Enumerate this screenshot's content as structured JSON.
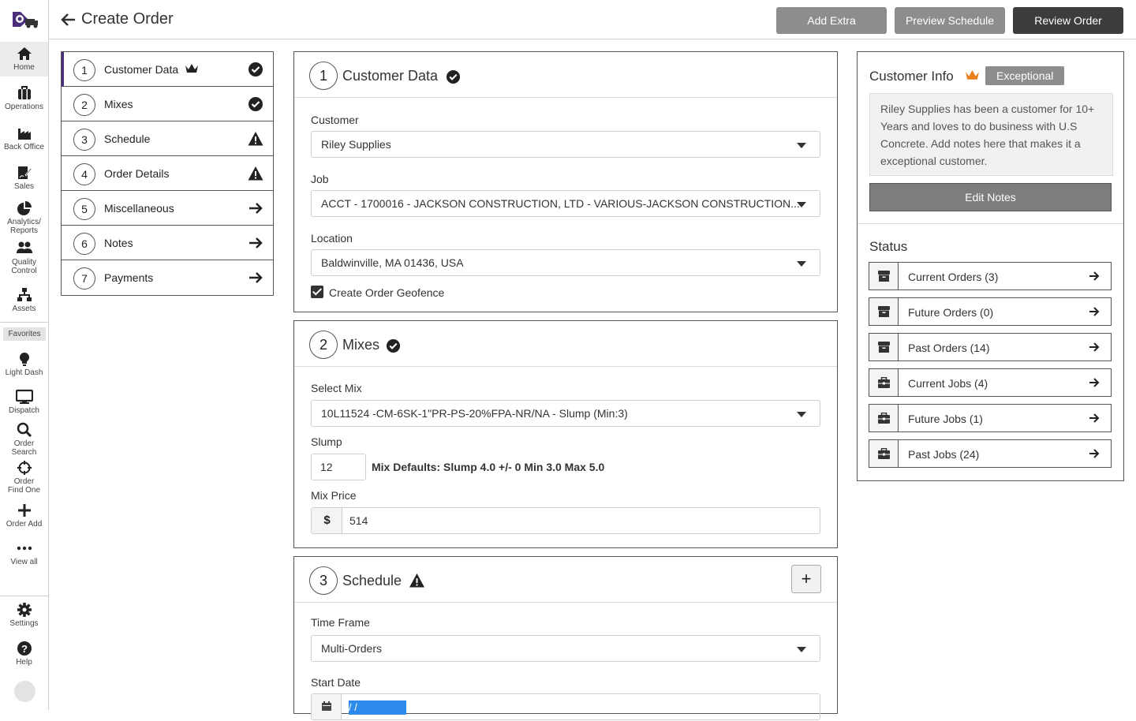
{
  "rail": {
    "items": [
      {
        "label": "Home",
        "icon": "home-icon"
      },
      {
        "label": "Operations",
        "icon": "briefcase-icon"
      },
      {
        "label": "Back Office",
        "icon": "factory-icon"
      },
      {
        "label": "Sales",
        "icon": "signature-icon"
      },
      {
        "label_lines": [
          "Analytics/",
          "Reports"
        ],
        "icon": "pie-chart-icon"
      },
      {
        "label_lines": [
          "Quality",
          "Control"
        ],
        "icon": "users-icon"
      },
      {
        "label": "Assets",
        "icon": "sitemap-icon"
      }
    ],
    "favorites_label": "Favorites",
    "favorites": [
      {
        "label": "Light Dash",
        "icon": "lightbulb-icon"
      },
      {
        "label": "Dispatch",
        "icon": "monitor-icon"
      },
      {
        "label_lines": [
          "Order",
          "Search"
        ],
        "icon": "search-icon"
      },
      {
        "label_lines": [
          "Order",
          "Find One"
        ],
        "icon": "crosshair-icon"
      },
      {
        "label": "Order Add",
        "icon": "plus-icon"
      },
      {
        "label": "View all",
        "icon": "ellipsis-icon"
      }
    ],
    "settings_label": "Settings",
    "help_label": "Help"
  },
  "header": {
    "title": "Create Order",
    "buttons": {
      "add_extra": "Add Extra",
      "preview_schedule": "Preview Schedule",
      "review_order": "Review Order"
    }
  },
  "steps": [
    {
      "num": "1",
      "label": "Customer Data",
      "status": "complete",
      "crown": true
    },
    {
      "num": "2",
      "label": "Mixes",
      "status": "complete"
    },
    {
      "num": "3",
      "label": "Schedule",
      "status": "warning"
    },
    {
      "num": "4",
      "label": "Order Details",
      "status": "warning"
    },
    {
      "num": "5",
      "label": "Miscellaneous",
      "status": "arrow"
    },
    {
      "num": "6",
      "label": "Notes",
      "status": "arrow"
    },
    {
      "num": "7",
      "label": "Payments",
      "status": "arrow"
    }
  ],
  "customer_data": {
    "num": "1",
    "title": "Customer Data",
    "customer_label": "Customer",
    "customer_value": "Riley Supplies",
    "job_label": "Job",
    "job_value": "ACCT -  1700016 - JACKSON CONSTRUCTION, LTD -  VARIOUS-JACKSON CONSTRUCTION...",
    "location_label": "Location",
    "location_value": "Baldwinville, MA 01436, USA",
    "geofence_label": "Create Order Geofence",
    "geofence_checked": true
  },
  "mixes": {
    "num": "2",
    "title": "Mixes",
    "select_mix_label": "Select Mix",
    "select_mix_value": "10L11524 -CM-6SK-1\"PR-PS-20%FPA-NR/NA - Slump (Min:3)",
    "slump_label": "Slump",
    "slump_value": "12",
    "mix_defaults": "Mix Defaults: Slump 4.0 +/- 0 Min 3.0 Max 5.0",
    "mix_price_label": "Mix Price",
    "currency_symbol": "$",
    "mix_price_value": "514"
  },
  "schedule": {
    "num": "3",
    "title": "Schedule",
    "add_symbol": "+",
    "time_frame_label": "Time Frame",
    "time_frame_value": "Multi-Orders",
    "start_date_label": "Start Date",
    "start_date_placeholder": "  /  /"
  },
  "customer_info": {
    "title": "Customer Info",
    "badge": "Exceptional",
    "notes": "Riley Supplies has been a customer for 10+ Years and loves to do business with U.S Concrete.  Add notes here that makes it a exceptional customer.",
    "edit_notes": "Edit Notes",
    "status_title": "Status",
    "status_rows": [
      {
        "label": "Current Orders (3)",
        "icon": "archive-icon"
      },
      {
        "label": "Future Orders (0)",
        "icon": "archive-icon"
      },
      {
        "label": "Past Orders (14)",
        "icon": "archive-icon"
      },
      {
        "label": "Current Jobs (4)",
        "icon": "briefcase-icon"
      },
      {
        "label": "Future Jobs (1)",
        "icon": "briefcase-icon"
      },
      {
        "label": "Past Jobs (24)",
        "icon": "briefcase-icon"
      }
    ]
  },
  "colors": {
    "accent": "#4b2f7d",
    "crown": "#e8801c",
    "dark_button": "#3d3d3d",
    "gray_button": "#8d8d8d"
  }
}
